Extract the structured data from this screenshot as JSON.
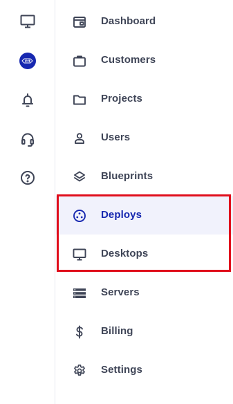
{
  "rail": {
    "items": [
      {
        "id": "desktop",
        "icon": "monitor-icon"
      },
      {
        "id": "logo",
        "icon": "brand-logo-icon"
      },
      {
        "id": "notifications",
        "icon": "bell-icon"
      },
      {
        "id": "support",
        "icon": "headset-icon"
      },
      {
        "id": "help",
        "icon": "question-circle-icon"
      }
    ]
  },
  "nav": {
    "items": [
      {
        "label": "Dashboard",
        "icon": "dashboard-icon"
      },
      {
        "label": "Customers",
        "icon": "briefcase-icon"
      },
      {
        "label": "Projects",
        "icon": "folder-icon"
      },
      {
        "label": "Users",
        "icon": "user-icon"
      },
      {
        "label": "Blueprints",
        "icon": "layers-icon"
      },
      {
        "label": "Deploys",
        "icon": "deploy-icon",
        "active": true
      },
      {
        "label": "Desktops",
        "icon": "monitor-icon"
      },
      {
        "label": "Servers",
        "icon": "server-icon"
      },
      {
        "label": "Billing",
        "icon": "dollar-icon"
      },
      {
        "label": "Settings",
        "icon": "gear-icon"
      }
    ]
  },
  "colors": {
    "text": "#3f4557",
    "active_text": "#1728b0",
    "active_background": "#f1f2fc",
    "highlight_border": "#e00d1b",
    "divider": "#e6e8ee"
  }
}
